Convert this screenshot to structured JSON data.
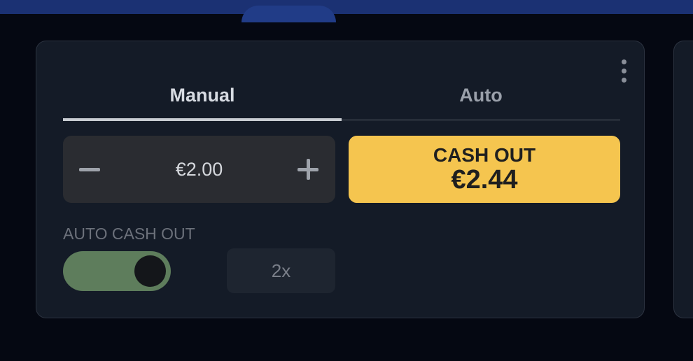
{
  "tabs": {
    "manual_label": "Manual",
    "auto_label": "Auto",
    "active": "Manual"
  },
  "bet": {
    "amount": "€2.00",
    "decrease_icon": "minus-icon",
    "increase_icon": "plus-icon"
  },
  "cashout": {
    "label": "CASH OUT",
    "amount": "€2.44",
    "color": "#f5c54f"
  },
  "auto_cashout": {
    "label": "AUTO CASH OUT",
    "enabled": true,
    "multiplier_value": "2x",
    "toggle_color": "#5e7d5c"
  },
  "menu": {
    "icon": "more-vertical-icon"
  }
}
